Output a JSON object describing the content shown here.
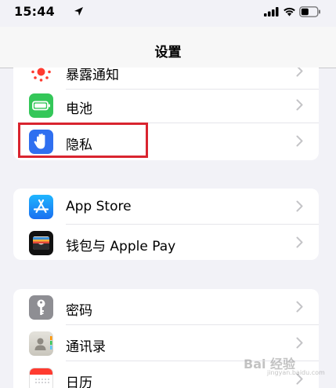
{
  "status": {
    "time": "15:44"
  },
  "nav": {
    "title": "设置"
  },
  "groups": [
    {
      "rows": [
        {
          "label": "暴露通知",
          "icon": "exposure-notification-icon",
          "color": "#ffffff"
        },
        {
          "label": "电池",
          "icon": "battery-icon",
          "color": "#34c759"
        },
        {
          "label": "隐私",
          "icon": "hand-icon",
          "color": "#2f6ff0"
        }
      ]
    },
    {
      "rows": [
        {
          "label": "App Store",
          "icon": "app-store-icon",
          "color": "#1a8cf6"
        },
        {
          "label": "钱包与 Apple Pay",
          "icon": "wallet-icon",
          "color": "#111111"
        }
      ]
    },
    {
      "rows": [
        {
          "label": "密码",
          "icon": "key-icon",
          "color": "#8e8e93"
        },
        {
          "label": "通讯录",
          "icon": "contacts-icon",
          "color": "#d8d6cf"
        },
        {
          "label": "日历",
          "icon": "calendar-icon",
          "color": "#ffffff"
        }
      ]
    }
  ],
  "watermark": {
    "text": "Bai 经验",
    "sub": "jingyan.baidu.com"
  },
  "colors": {
    "background": "#f2f2f7",
    "highlight": "#d9242f",
    "chevron": "#c4c4c7"
  }
}
